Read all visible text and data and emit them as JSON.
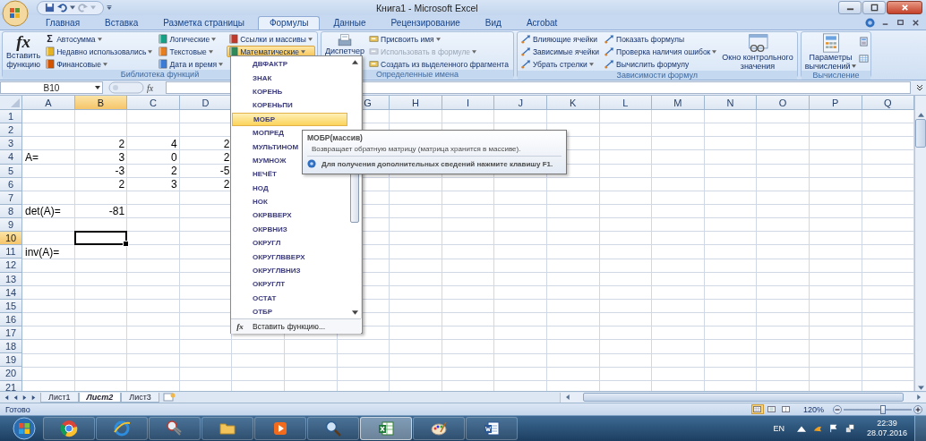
{
  "window": {
    "title": "Книга1 - Microsoft Excel"
  },
  "tabs": [
    {
      "label": "Главная",
      "selected": false
    },
    {
      "label": "Вставка",
      "selected": false
    },
    {
      "label": "Разметка страницы",
      "selected": false
    },
    {
      "label": "Формулы",
      "selected": true
    },
    {
      "label": "Данные",
      "selected": false
    },
    {
      "label": "Рецензирование",
      "selected": false
    },
    {
      "label": "Вид",
      "selected": false
    },
    {
      "label": "Acrobat",
      "selected": false
    }
  ],
  "ribbon": {
    "groups": [
      {
        "label": "Библиотека функций",
        "parts": [
          {
            "kind": "big",
            "glyph": "fx",
            "lines": [
              "Вставить",
              "функцию"
            ],
            "dropdown": false
          },
          {
            "kind": "column",
            "items": [
              {
                "label": "Автосумма",
                "glyph": "Σ",
                "dropdown": true,
                "disabled": false,
                "open": false
              },
              {
                "label": "Недавно использовались",
                "dropdown": true,
                "disabled": false,
                "open": false
              },
              {
                "label": "Финансовые",
                "dropdown": true,
                "disabled": false,
                "open": false
              }
            ]
          },
          {
            "kind": "column",
            "items": [
              {
                "label": "Логические",
                "dropdown": true,
                "disabled": false,
                "open": false
              },
              {
                "label": "Текстовые",
                "dropdown": true,
                "disabled": false,
                "open": false
              },
              {
                "label": "Дата и время",
                "dropdown": true,
                "disabled": false,
                "open": false
              }
            ]
          },
          {
            "kind": "column",
            "items": [
              {
                "label": "Ссылки и массивы",
                "dropdown": true,
                "disabled": false,
                "open": false
              },
              {
                "label": "Математические",
                "dropdown": true,
                "disabled": false,
                "open": true
              }
            ]
          }
        ]
      },
      {
        "label": "Определенные имена",
        "parts": [
          {
            "kind": "big",
            "lines": [
              "Диспетчер"
            ],
            "dropdown": false
          },
          {
            "kind": "column",
            "items": [
              {
                "label": "Присвоить имя",
                "dropdown": true,
                "disabled": false,
                "open": false
              },
              {
                "label": "Использовать в формуле",
                "dropdown": true,
                "disabled": true,
                "open": false
              },
              {
                "label": "Создать из выделенного фрагмента",
                "dropdown": false,
                "disabled": false,
                "open": false
              }
            ]
          }
        ]
      },
      {
        "label": "Зависимости формул",
        "parts": [
          {
            "kind": "column",
            "items": [
              {
                "label": "Влияющие ячейки",
                "dropdown": false,
                "disabled": false,
                "open": false
              },
              {
                "label": "Зависимые ячейки",
                "dropdown": false,
                "disabled": false,
                "open": false
              },
              {
                "label": "Убрать стрелки",
                "dropdown": true,
                "disabled": false,
                "open": false
              }
            ]
          },
          {
            "kind": "column",
            "items": [
              {
                "label": "Показать формулы",
                "dropdown": false,
                "disabled": false,
                "open": false
              },
              {
                "label": "Проверка наличия ошибок",
                "dropdown": true,
                "disabled": false,
                "open": false
              },
              {
                "label": "Вычислить формулу",
                "dropdown": false,
                "disabled": false,
                "open": false
              }
            ]
          },
          {
            "kind": "big",
            "lines": [
              "Окно контрольного",
              "значения"
            ],
            "dropdown": false
          }
        ]
      },
      {
        "label": "Вычисление",
        "parts": [
          {
            "kind": "big",
            "lines": [
              "Параметры",
              "вычислений"
            ],
            "dropdown": true
          },
          {
            "kind": "icon_column"
          }
        ]
      }
    ]
  },
  "formula_bar": {
    "name_box": "B10",
    "function_glyph": "fx"
  },
  "sheet": {
    "columns": [
      {
        "label": "A",
        "selected": false
      },
      {
        "label": "B",
        "selected": true
      },
      {
        "label": "C",
        "selected": false
      },
      {
        "label": "D",
        "selected": false
      },
      {
        "label": "G",
        "selected": false
      },
      {
        "label": "H",
        "selected": false
      },
      {
        "label": "I",
        "selected": false
      },
      {
        "label": "J",
        "selected": false
      },
      {
        "label": "K",
        "selected": false
      },
      {
        "label": "L",
        "selected": false
      },
      {
        "label": "M",
        "selected": false
      },
      {
        "label": "N",
        "selected": false
      },
      {
        "label": "O",
        "selected": false
      },
      {
        "label": "P",
        "selected": false
      },
      {
        "label": "Q",
        "selected": false
      }
    ],
    "rows": [
      {
        "label": "1",
        "selected": false
      },
      {
        "label": "2",
        "selected": false
      },
      {
        "label": "3",
        "selected": false,
        "cells": {
          "B": {
            "value": "2",
            "kind": "number"
          },
          "C": {
            "value": "4",
            "kind": "number"
          },
          "D": {
            "value": "2",
            "kind": "number"
          }
        }
      },
      {
        "label": "4",
        "selected": false,
        "cells": {
          "A": {
            "value": "A=",
            "kind": "text"
          },
          "B": {
            "value": "3",
            "kind": "number"
          },
          "C": {
            "value": "0",
            "kind": "number"
          },
          "D": {
            "value": "2",
            "kind": "number"
          }
        }
      },
      {
        "label": "5",
        "selected": false,
        "cells": {
          "B": {
            "value": "-3",
            "kind": "number"
          },
          "C": {
            "value": "2",
            "kind": "number"
          },
          "D": {
            "value": "-5",
            "kind": "number"
          }
        }
      },
      {
        "label": "6",
        "selected": false,
        "cells": {
          "B": {
            "value": "2",
            "kind": "number"
          },
          "C": {
            "value": "3",
            "kind": "number"
          },
          "D": {
            "value": "2",
            "kind": "number"
          }
        }
      },
      {
        "label": "7",
        "selected": false
      },
      {
        "label": "8",
        "selected": false,
        "cells": {
          "A": {
            "value": "det(A)=",
            "kind": "text"
          },
          "B": {
            "value": "-81",
            "kind": "number"
          }
        }
      },
      {
        "label": "9",
        "selected": false
      },
      {
        "label": "10",
        "selected": true
      },
      {
        "label": "11",
        "selected": false,
        "cells": {
          "A": {
            "value": "inv(A)=",
            "kind": "text"
          }
        }
      },
      {
        "label": "12",
        "selected": false
      },
      {
        "label": "13",
        "selected": false
      },
      {
        "label": "14",
        "selected": false
      },
      {
        "label": "15",
        "selected": false
      },
      {
        "label": "16",
        "selected": false
      },
      {
        "label": "17",
        "selected": false
      },
      {
        "label": "18",
        "selected": false
      },
      {
        "label": "19",
        "selected": false
      },
      {
        "label": "20",
        "selected": false
      },
      {
        "label": "21",
        "selected": false
      }
    ]
  },
  "function_menu": {
    "items": [
      {
        "label": "ДВФАКТР",
        "selected": false
      },
      {
        "label": "ЗНАК",
        "selected": false
      },
      {
        "label": "КОРЕНЬ",
        "selected": false
      },
      {
        "label": "КОРЕНЬПИ",
        "selected": false
      },
      {
        "label": "МОБР",
        "selected": true
      },
      {
        "label": "МОПРЕД",
        "selected": false
      },
      {
        "label": "МУЛЬТИНОМ",
        "selected": false
      },
      {
        "label": "МУМНОЖ",
        "selected": false
      },
      {
        "label": "НЕЧЁТ",
        "selected": false
      },
      {
        "label": "НОД",
        "selected": false
      },
      {
        "label": "НОК",
        "selected": false
      },
      {
        "label": "ОКРВВЕРХ",
        "selected": false
      },
      {
        "label": "ОКРВНИЗ",
        "selected": false
      },
      {
        "label": "ОКРУГЛ",
        "selected": false
      },
      {
        "label": "ОКРУГЛВВЕРХ",
        "selected": false
      },
      {
        "label": "ОКРУГЛВНИЗ",
        "selected": false
      },
      {
        "label": "ОКРУГЛТ",
        "selected": false
      },
      {
        "label": "ОСТАТ",
        "selected": false
      },
      {
        "label": "ОТБР",
        "selected": false
      }
    ],
    "footer": {
      "glyph": "fx",
      "label": "Вставить функцию..."
    }
  },
  "tooltip": {
    "title": "МОБР(массив)",
    "description": "Возвращает обратную матрицу (матрица хранится в массиве).",
    "help": "Для получения дополнительных сведений нажмите клавишу F1."
  },
  "sheet_tabs": [
    {
      "label": "Лист1",
      "selected": false
    },
    {
      "label": "Лист2",
      "selected": true
    },
    {
      "label": "Лист3",
      "selected": false
    }
  ],
  "status_bar": {
    "text": "Готово",
    "views": [
      {
        "selected": true
      },
      {
        "selected": false
      },
      {
        "selected": false
      }
    ],
    "zoom": "120%",
    "zoom_slider": {
      "level": 0.58
    }
  },
  "taskbar": {
    "apps": [
      {
        "active": false
      },
      {
        "active": false
      },
      {
        "active": false
      },
      {
        "active": false
      },
      {
        "active": false
      },
      {
        "active": false
      },
      {
        "active": true
      },
      {
        "active": false
      },
      {
        "active": false
      }
    ],
    "language": "EN",
    "time": "22:39",
    "date": "28.07.2016"
  }
}
